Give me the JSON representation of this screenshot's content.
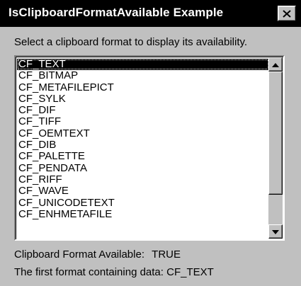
{
  "window": {
    "title": "IsClipboardFormatAvailable Example",
    "close_icon": "close-x-icon"
  },
  "prompt": "Select a clipboard format to display its availability.",
  "listbox": {
    "selected_index": 0,
    "items": [
      "CF_TEXT",
      "CF_BITMAP",
      "CF_METAFILEPICT",
      "CF_SYLK",
      "CF_DIF",
      "CF_TIFF",
      "CF_OEMTEXT",
      "CF_DIB",
      "CF_PALETTE",
      "CF_PENDATA",
      "CF_RIFF",
      "CF_WAVE",
      "CF_UNICODETEXT",
      "CF_ENHMETAFILE"
    ],
    "scroll_up_icon": "triangle-up-icon",
    "scroll_down_icon": "triangle-down-icon"
  },
  "status": {
    "available_label": "Clipboard Format Available:",
    "available_value": "TRUE",
    "first_format_label": "The first format containing data:",
    "first_format_value": "CF_TEXT"
  }
}
